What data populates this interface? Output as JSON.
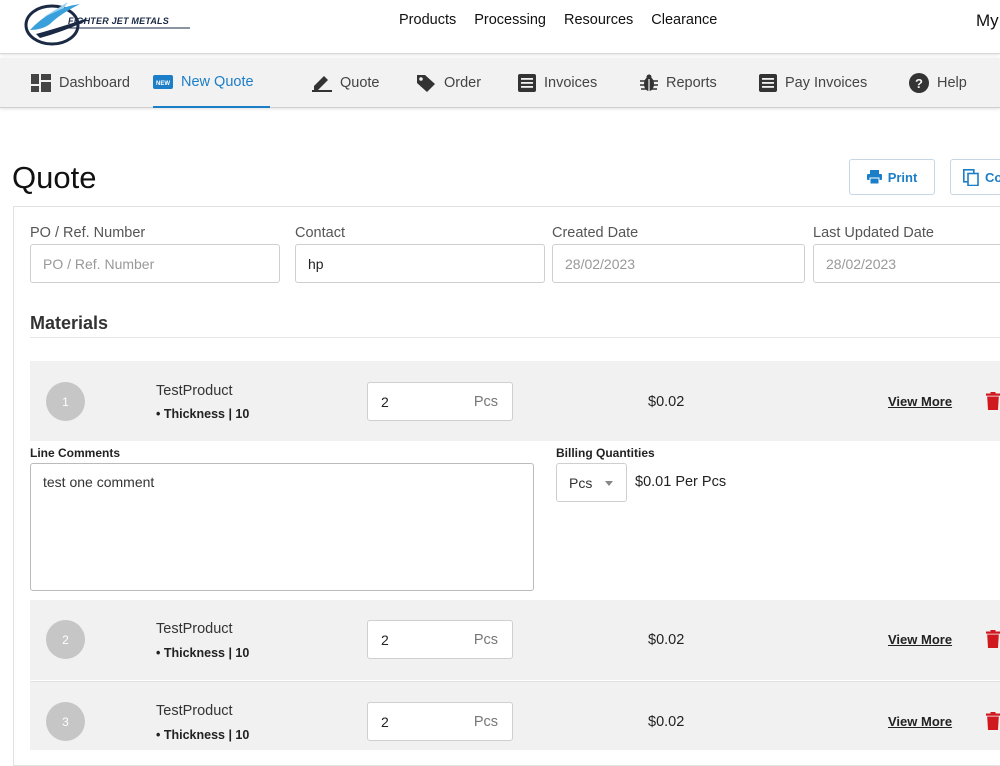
{
  "brand": {
    "logo_text": "FIGHTER JET METALS"
  },
  "topnav": {
    "links": [
      "Products",
      "Processing",
      "Resources",
      "Clearance"
    ],
    "account": "My"
  },
  "subnav": {
    "items": [
      {
        "label": "Dashboard",
        "icon": "dashboard-icon"
      },
      {
        "label": "New Quote",
        "icon": "new-badge-icon",
        "badge": "NEW",
        "active": true
      },
      {
        "label": "Quote",
        "icon": "pencil-icon"
      },
      {
        "label": "Order",
        "icon": "tag-icon"
      },
      {
        "label": "Invoices",
        "icon": "document-icon"
      },
      {
        "label": "Reports",
        "icon": "bug-icon"
      },
      {
        "label": "Pay Invoices",
        "icon": "document-icon"
      },
      {
        "label": "Help",
        "icon": "help-icon"
      }
    ]
  },
  "page": {
    "title": "Quote",
    "print_label": "Print",
    "copy_label": "Co"
  },
  "form": {
    "po": {
      "label": "PO / Ref. Number",
      "placeholder": "PO / Ref. Number",
      "value": ""
    },
    "contact": {
      "label": "Contact",
      "value": "hp"
    },
    "created": {
      "label": "Created Date",
      "value": "28/02/2023"
    },
    "updated": {
      "label": "Last Updated Date",
      "value": "28/02/2023"
    }
  },
  "materials": {
    "heading": "Materials",
    "view_more_label": "View More",
    "rows": [
      {
        "num": "1",
        "name": "TestProduct",
        "attr": "• Thickness | 10",
        "qty": "2",
        "unit": "Pcs",
        "price": "$0.02"
      },
      {
        "num": "2",
        "name": "TestProduct",
        "attr": "• Thickness | 10",
        "qty": "2",
        "unit": "Pcs",
        "price": "$0.02"
      },
      {
        "num": "3",
        "name": "TestProduct",
        "attr": "• Thickness | 10",
        "qty": "2",
        "unit": "Pcs",
        "price": "$0.02"
      }
    ],
    "detail": {
      "comments_label": "Line Comments",
      "comment": "test one comment",
      "billing_label": "Billing Quantities",
      "billing_unit": "Pcs",
      "per_unit": "$0.01 Per Pcs"
    }
  },
  "colors": {
    "accent": "#1c7ec7",
    "danger": "#d0191e"
  }
}
